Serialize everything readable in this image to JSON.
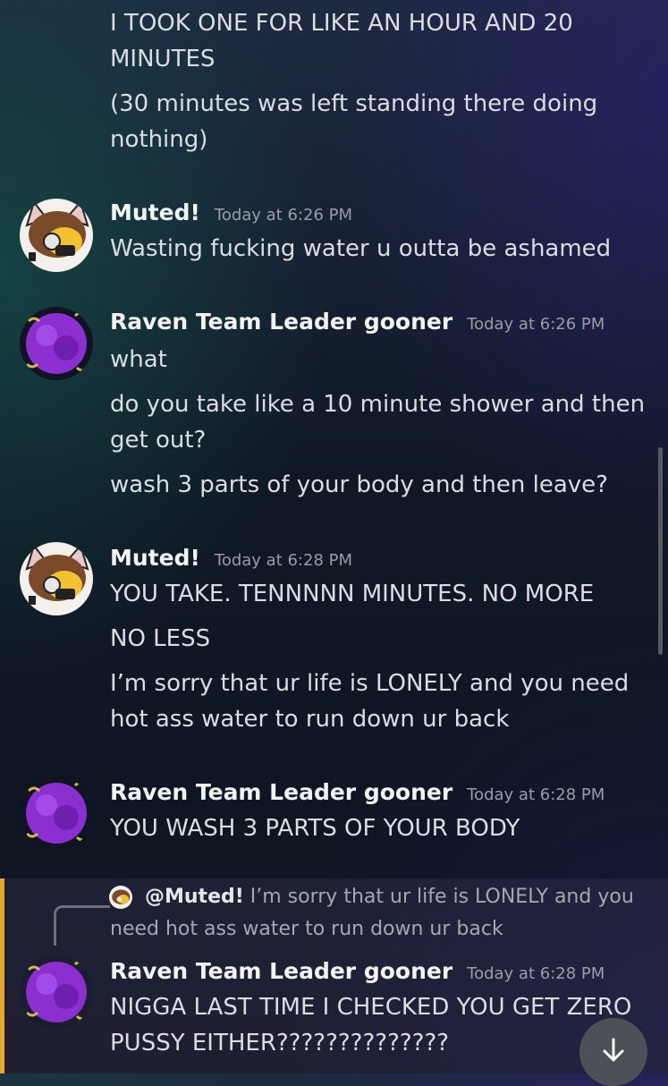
{
  "messages": [
    {
      "continuation_lines": [
        "I TOOK ONE FOR LIKE AN HOUR AND 20",
        "MINUTES",
        "(30 minutes was left standing there doing",
        "nothing)"
      ]
    },
    {
      "author": "Muted!",
      "timestamp": "Today at 6:26 PM",
      "avatar_icon": "cat-avatar-icon",
      "lines": [
        "Wasting fucking water u outta be ashamed"
      ]
    },
    {
      "author": "Raven Team Leader gooner",
      "timestamp": "Today at 6:26 PM",
      "avatar_icon": "purple-raven-avatar-icon",
      "lines": [
        "what",
        "do you take like a 10 minute shower and then",
        "get out?",
        "wash 3 parts of your body and then leave?"
      ]
    },
    {
      "author": "Muted!",
      "timestamp": "Today at 6:28 PM",
      "avatar_icon": "cat-avatar-icon",
      "lines": [
        "YOU TAKE. TENNNNN MINUTES. NO MORE",
        "NO LESS",
        "I’m sorry that ur life is LONELY and you need",
        "hot ass water to run down ur back"
      ]
    },
    {
      "author": "Raven Team Leader gooner",
      "timestamp": "Today at 6:28 PM",
      "avatar_icon": "purple-raven-avatar-icon",
      "lines": [
        "YOU WASH 3 PARTS OF YOUR BODY"
      ]
    },
    {
      "author": "Raven Team Leader gooner",
      "timestamp": "Today at 6:28 PM",
      "avatar_icon": "purple-raven-avatar-icon",
      "reply": {
        "mention": "@Muted!",
        "text_line1": "I’m sorry that ur life is LONELY and you",
        "text_line2": "need hot ass water to run down ur back"
      },
      "lines": [
        "NIGGA LAST TIME I CHECKED YOU GET ZERO",
        "PUSSY EITHER??????????????"
      ]
    }
  ],
  "ui": {
    "jump_button_icon": "arrow-down-icon",
    "highlight_color": "#e8a62b"
  }
}
